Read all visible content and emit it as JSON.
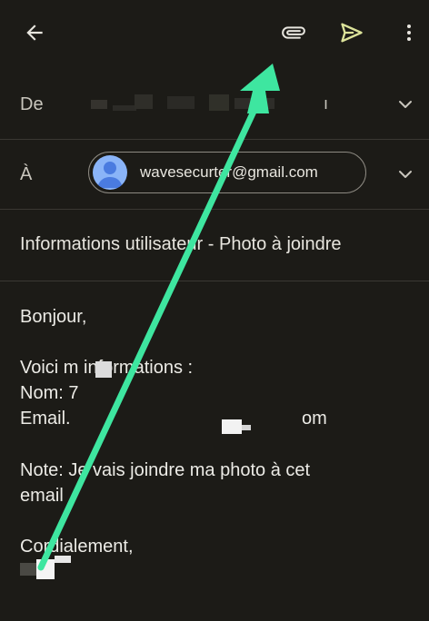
{
  "toolbar": {
    "back_icon": "arrow-left-icon",
    "attach_icon": "paperclip-icon",
    "send_icon": "send-icon",
    "more_icon": "more-vert-icon",
    "send_color": "#dce39a"
  },
  "from": {
    "label": "De",
    "value_suffix": "ı"
  },
  "to": {
    "label": "À",
    "recipient_email": "wavesecurter@gmail.com"
  },
  "subject": "Informations utilisateur - Photo à joindre",
  "message": {
    "greeting": "Bonjour,",
    "line_intro": "Voici m informations :",
    "line_name": "Nom: 7",
    "line_email_start": "Email.",
    "line_email_end": "om",
    "line_note_1": "Note: Je vais joindre ma photo à cet",
    "line_note_2": "email",
    "closing": "Cordialement,"
  },
  "annotation": {
    "arrow_color": "#3ee6a0"
  }
}
